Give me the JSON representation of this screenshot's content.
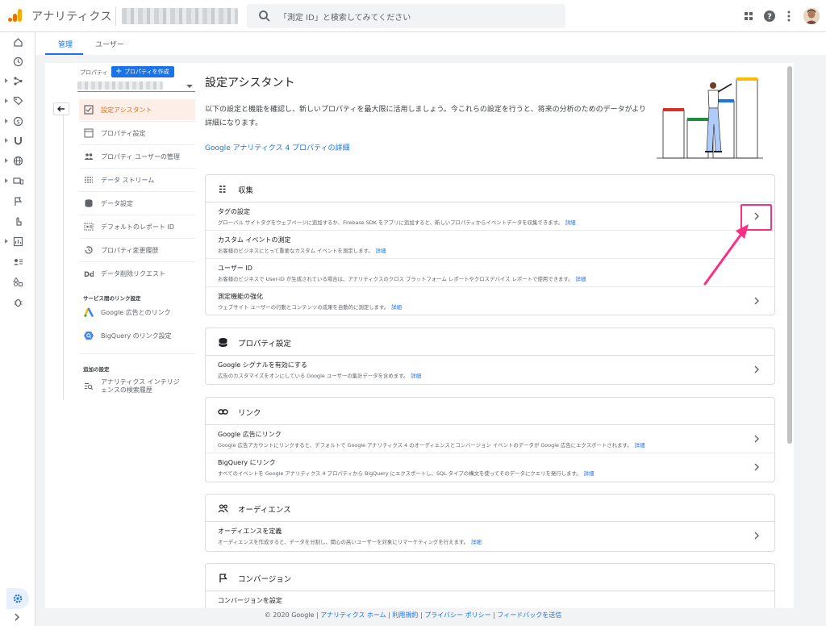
{
  "app": {
    "title": "アナリティクス",
    "search_placeholder": "「測定 ID」と検索してみてください"
  },
  "tabs": [
    {
      "label": "管理"
    },
    {
      "label": "ユーザー"
    }
  ],
  "property": {
    "label": "プロパティ",
    "create_button": "プロパティを作成"
  },
  "nav": {
    "items": [
      {
        "label": "設定アシスタント"
      },
      {
        "label": "プロパティ設定"
      },
      {
        "label": "プロパティ ユーザーの管理"
      },
      {
        "label": "データ ストリーム"
      },
      {
        "label": "データ設定"
      },
      {
        "label": "デフォルトのレポート ID"
      },
      {
        "label": "プロパティ変更履歴"
      },
      {
        "label": "データ削除リクエスト"
      }
    ],
    "section_links": "サービス間のリンク設定",
    "links": [
      {
        "label": "Google 広告とのリンク"
      },
      {
        "label": "BigQuery のリンク設定"
      }
    ],
    "section_additional": "追加の設定",
    "additional": [
      {
        "line1": "アナリティクス インテリジ",
        "line2": "ェンスの検索履歴"
      }
    ]
  },
  "main": {
    "title": "設定アシスタント",
    "intro": "以下の設定と機能を確認し、新しいプロパティを最大限に活用しましょう。今これらの設定を行うと、将来の分析のためのデータがより詳細になります。",
    "learn_more_link": "Google アナリティクス 4 プロパティの詳細"
  },
  "sections": [
    {
      "title": "収集",
      "rows": [
        {
          "title": "タグの設定",
          "desc": "グローバル サイトタグをウェブページに追加するか、Firebase SDK をアプリに追加すると、新しいプロパティからイベントデータを収集できます。",
          "link": "詳細"
        },
        {
          "title": "カスタム イベントの測定",
          "desc": "お客様のビジネスにとって重要なカスタム イベントを測定します。",
          "link": "詳細"
        },
        {
          "title": "ユーザー ID",
          "desc": "お客様のビジネスで User-ID が生成されている場合は、アナリティクスのクロス プラットフォーム レポートやクロスデバイス レポートで使用できます。",
          "link": "詳細"
        },
        {
          "title": "測定機能の強化",
          "desc": "ウェブサイト ユーザーの行動とコンテンツの成果を自動的に測定します。",
          "link": "詳細"
        }
      ]
    },
    {
      "title": "プロパティ設定",
      "rows": [
        {
          "title": "Google シグナルを有効にする",
          "desc": "広告のカスタマイズをオンにしている Google ユーザーの集計データを含めます。",
          "link": "詳細"
        }
      ]
    },
    {
      "title": "リンク",
      "rows": [
        {
          "title": "Google 広告にリンク",
          "desc": "Google 広告アカウントにリンクすると、デフォルトで Google アナリティクス 4 のオーディエンスとコンバージョン イベントのデータが Google 広告にエクスポートされます。",
          "link": "詳細"
        },
        {
          "title": "BigQuery にリンク",
          "desc": "すべてのイベントを Google アナリティクス 4 プロパティから BigQuery にエクスポートし、SQL タイプの構文を使ってそのデータにクエリを発行します。",
          "link": "詳細"
        }
      ]
    },
    {
      "title": "オーディエンス",
      "rows": [
        {
          "title": "オーディエンスを定義",
          "desc": "オーディエンスを作成すると、データを分割し、関心の高いユーザーを対象にリマーケティングを行えます。",
          "link": "詳細"
        }
      ]
    },
    {
      "title": "コンバージョン",
      "rows": [
        {
          "title": "コンバージョンを設定",
          "desc": "",
          "link": ""
        }
      ]
    }
  ],
  "footer": {
    "copyright": "© 2020 Google",
    "links": [
      "アナリティクス ホーム",
      "利用規約",
      "プライバシー ポリシー",
      "フィードバックを送信"
    ]
  },
  "colors": {
    "accent": "#1a73e8",
    "active_nav": "#e8710a",
    "highlight": "#ff2d84"
  }
}
